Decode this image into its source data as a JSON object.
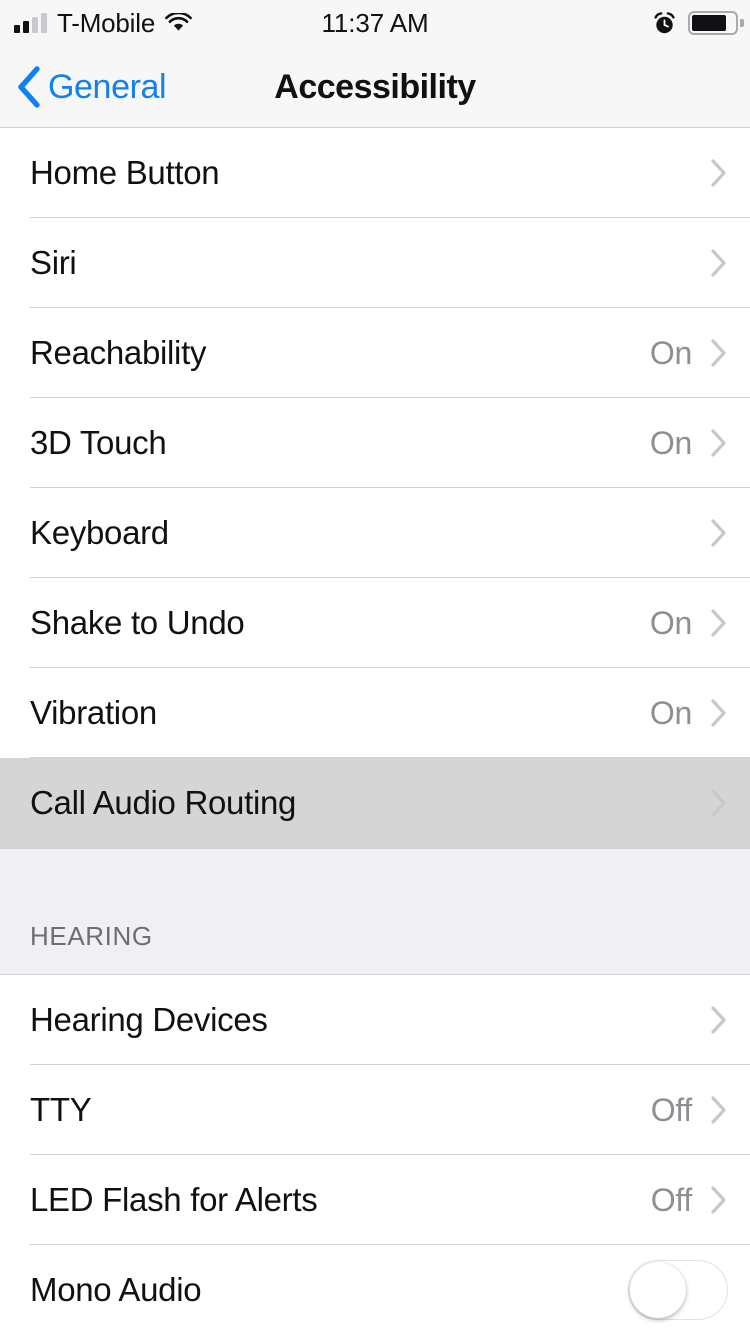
{
  "status_bar": {
    "carrier": "T-Mobile",
    "time": "11:37 AM",
    "signal_bars_total": 4,
    "signal_bars_active": 2,
    "wifi_icon": "wifi-icon",
    "alarm_icon": "alarm-clock-icon",
    "battery_icon": "battery-icon",
    "battery_percent": 80
  },
  "nav_bar": {
    "back_label": "General",
    "back_icon": "chevron-left-icon",
    "title": "Accessibility",
    "tint_color": "#1281F0"
  },
  "interaction": {
    "colors": {
      "accent": "#1281F0",
      "row_bg": "#FFFFFF",
      "pressed_row_bg": "#D5D5D5",
      "section_bg": "#EFEFF4",
      "separator": "#D3D3D6",
      "value_text": "#8E8E93",
      "chevron": "#C7C7CC",
      "label_text": "#111114",
      "switch_off_track": "#FFFFFF"
    }
  },
  "sections": [
    {
      "header": null,
      "rows": [
        {
          "label": "Home Button",
          "value": "",
          "accessory": "disclosure",
          "pressed": false
        },
        {
          "label": "Siri",
          "value": "",
          "accessory": "disclosure",
          "pressed": false
        },
        {
          "label": "Reachability",
          "value": "On",
          "accessory": "disclosure",
          "pressed": false
        },
        {
          "label": "3D Touch",
          "value": "On",
          "accessory": "disclosure",
          "pressed": false
        },
        {
          "label": "Keyboard",
          "value": "",
          "accessory": "disclosure",
          "pressed": false
        },
        {
          "label": "Shake to Undo",
          "value": "On",
          "accessory": "disclosure",
          "pressed": false
        },
        {
          "label": "Vibration",
          "value": "On",
          "accessory": "disclosure",
          "pressed": false
        },
        {
          "label": "Call Audio Routing",
          "value": "",
          "accessory": "disclosure",
          "pressed": true
        }
      ]
    },
    {
      "header": "HEARING",
      "rows": [
        {
          "label": "Hearing Devices",
          "value": "",
          "accessory": "disclosure",
          "pressed": false
        },
        {
          "label": "TTY",
          "value": "Off",
          "accessory": "disclosure",
          "pressed": false
        },
        {
          "label": "LED Flash for Alerts",
          "value": "Off",
          "accessory": "disclosure",
          "pressed": false
        },
        {
          "label": "Mono Audio",
          "value": "",
          "accessory": "switch",
          "switch_on": false,
          "pressed": false
        }
      ]
    }
  ]
}
